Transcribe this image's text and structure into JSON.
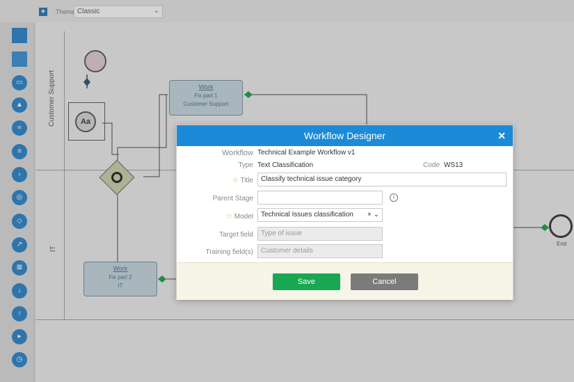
{
  "toolbar": {
    "plus_label": "+",
    "theme_label": "Theme",
    "theme_value": "Classic"
  },
  "palette": {
    "icon_names": [
      "square-icon",
      "form-icon",
      "mail-icon",
      "bell-icon",
      "share-icon",
      "database-icon",
      "terminal-icon",
      "settings-icon",
      "lock-icon",
      "export-icon",
      "inbox-icon",
      "download-icon",
      "upload-icon",
      "file-icon",
      "clock-icon"
    ]
  },
  "canvas": {
    "lane1_label": "Customer Support",
    "lane2_label": "IT",
    "task1": {
      "title": "Work",
      "subtitle": "Fix part 1",
      "group": "Customer Support"
    },
    "task2": {
      "title": "Work",
      "subtitle": "Fix part 2",
      "group": "IT"
    },
    "aa_label": "Aa",
    "end_label": "End"
  },
  "dialog": {
    "title": "Workflow Designer",
    "close_symbol": "✕",
    "workflow_label": "Workflow",
    "workflow_value": "Technical Example Workflow v1",
    "type_label": "Type",
    "type_value": "Text Classification",
    "code_label": "Code",
    "code_value": "WS13",
    "title_label": "Title",
    "title_value": "Classify technical issue category",
    "parent_stage_label": "Parent Stage",
    "parent_stage_value": "",
    "info_symbol": "i",
    "model_label": "Model",
    "model_value": "Technical Issues classification",
    "target_field_label": "Target field",
    "target_field_placeholder": "Type of issue",
    "training_fields_label": "Training field(s)",
    "training_fields_placeholder": "Customer details",
    "save_label": "Save",
    "cancel_label": "Cancel",
    "required_symbol": "☆",
    "accent": "#1c8ad6",
    "save_color": "#1aa752",
    "cancel_color": "#7b7b7b"
  }
}
